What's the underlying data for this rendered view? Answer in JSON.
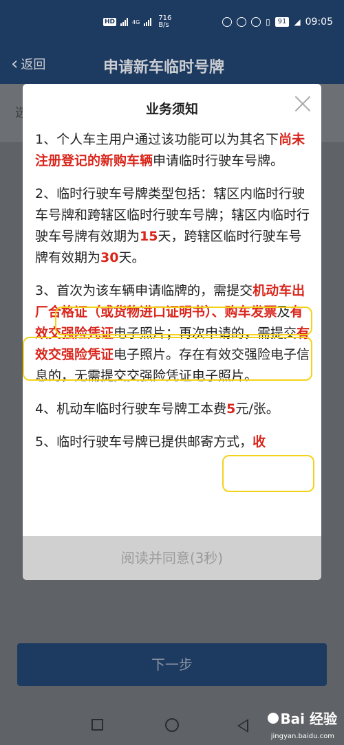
{
  "status_bar": {
    "hd": "HD",
    "net_label": "4G",
    "speed_value": "716",
    "speed_unit": "B/s",
    "battery": "91",
    "time": "09:05"
  },
  "header": {
    "back_label": "返回",
    "title": "申请新车临时号牌"
  },
  "underlay": {
    "first_char": "选"
  },
  "modal": {
    "title": "业务须知",
    "paragraphs": [
      [
        {
          "t": "1、个人车主用户通过该功能可以为其名下"
        },
        {
          "t": "尚未注册登记的新购车辆",
          "red": true
        },
        {
          "t": "申请临时行驶车号牌。"
        }
      ],
      [
        {
          "t": "2、临时行驶车号牌类型包括：辖区内临时行驶车号牌和跨辖区临时行驶车号牌；辖区内临时行驶车号牌有效期为"
        },
        {
          "t": "15",
          "red": true
        },
        {
          "t": "天，跨辖区临时行驶车号牌有效期为"
        },
        {
          "t": "30",
          "red": true
        },
        {
          "t": "天。"
        }
      ],
      [
        {
          "t": "3、首次为该车辆申请临牌的，需提交"
        },
        {
          "t": "机动车出厂合格证（或货物进口证明书）、购车发票",
          "red": true
        },
        {
          "t": "及"
        },
        {
          "t": "有效交强险凭证",
          "red": true
        },
        {
          "t": "电子照片；再次申请的，需提交"
        },
        {
          "t": "有效交强险凭证",
          "red": true
        },
        {
          "t": "电子照片。存在有效交强险电子信息的，无需提交交强险凭证电子照片。"
        }
      ],
      [
        {
          "t": "4、机动车临时行驶车号牌工本费"
        },
        {
          "t": "5",
          "red": true
        },
        {
          "t": "元/张。"
        }
      ],
      [
        {
          "t": "5、临时行驶车号牌已提供邮寄方式，"
        },
        {
          "t": "收",
          "red": true
        }
      ]
    ],
    "agree_label": "阅读并同意(3秒)"
  },
  "next_label": "下一步",
  "watermark": {
    "brand": "Bai 经验",
    "url": "jingyan.baidu.com"
  }
}
